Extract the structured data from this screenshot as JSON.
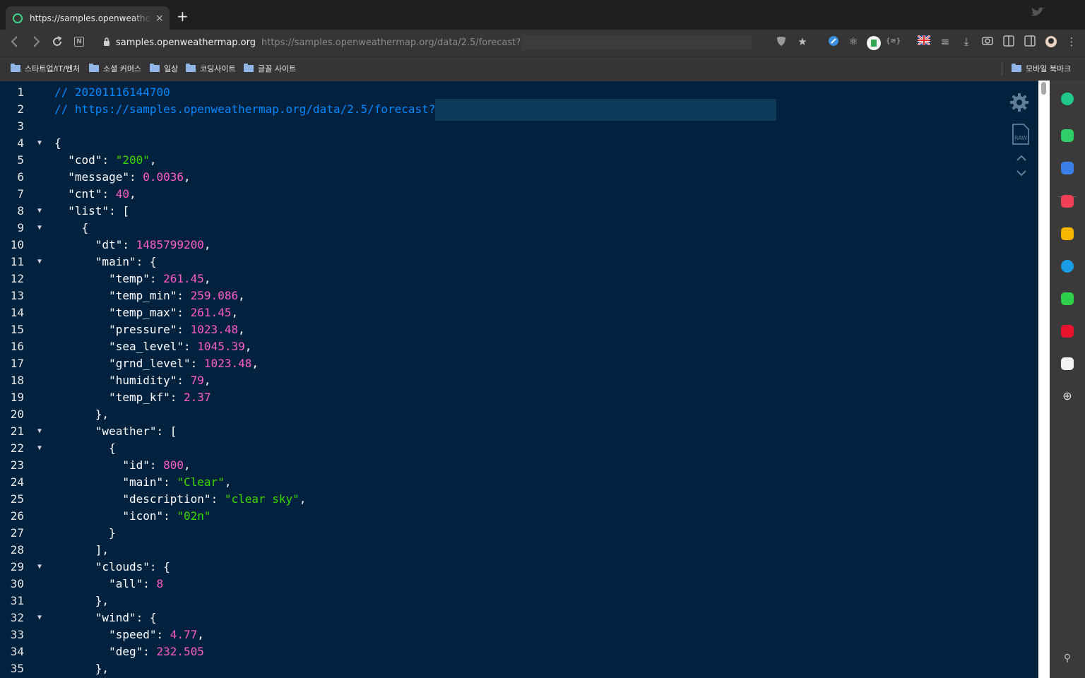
{
  "tab": {
    "title": "https://samples.openweathermap.org",
    "close": "×",
    "new": "+"
  },
  "address": {
    "host": "samples.openweathermap.org",
    "url": "https://samples.openweathermap.org/data/2.5/forecast?"
  },
  "bookmarks": [
    {
      "label": "스타트업/IT/벤처"
    },
    {
      "label": "소셜 커머스"
    },
    {
      "label": "일상"
    },
    {
      "label": "코딩사이트"
    },
    {
      "label": "글꼴 사이트"
    }
  ],
  "mobile_bookmarks": "모바일 북마크",
  "code_lines": [
    {
      "n": "1",
      "fold": "",
      "tokens": [
        [
          "c",
          "// 20201116144700"
        ]
      ]
    },
    {
      "n": "2",
      "fold": "",
      "tokens": [
        [
          "c",
          "// https://samples.openweathermap.org/data/2.5/forecast?"
        ]
      ]
    },
    {
      "n": "3",
      "fold": "",
      "tokens": []
    },
    {
      "n": "4",
      "fold": "▼",
      "tokens": [
        [
          "p",
          "{"
        ]
      ]
    },
    {
      "n": "5",
      "fold": "",
      "tokens": [
        [
          "p",
          "  "
        ],
        [
          "k",
          "\"cod\""
        ],
        [
          "p",
          ": "
        ],
        [
          "s",
          "\"200\""
        ],
        [
          "p",
          ","
        ]
      ]
    },
    {
      "n": "6",
      "fold": "",
      "tokens": [
        [
          "p",
          "  "
        ],
        [
          "k",
          "\"message\""
        ],
        [
          "p",
          ": "
        ],
        [
          "n",
          "0.0036"
        ],
        [
          "p",
          ","
        ]
      ]
    },
    {
      "n": "7",
      "fold": "",
      "tokens": [
        [
          "p",
          "  "
        ],
        [
          "k",
          "\"cnt\""
        ],
        [
          "p",
          ": "
        ],
        [
          "n",
          "40"
        ],
        [
          "p",
          ","
        ]
      ]
    },
    {
      "n": "8",
      "fold": "▼",
      "tokens": [
        [
          "p",
          "  "
        ],
        [
          "k",
          "\"list\""
        ],
        [
          "p",
          ": ["
        ]
      ]
    },
    {
      "n": "9",
      "fold": "▼",
      "tokens": [
        [
          "p",
          "    {"
        ]
      ]
    },
    {
      "n": "10",
      "fold": "",
      "tokens": [
        [
          "p",
          "      "
        ],
        [
          "k",
          "\"dt\""
        ],
        [
          "p",
          ": "
        ],
        [
          "n",
          "1485799200"
        ],
        [
          "p",
          ","
        ]
      ]
    },
    {
      "n": "11",
      "fold": "▼",
      "tokens": [
        [
          "p",
          "      "
        ],
        [
          "k",
          "\"main\""
        ],
        [
          "p",
          ": {"
        ]
      ]
    },
    {
      "n": "12",
      "fold": "",
      "tokens": [
        [
          "p",
          "        "
        ],
        [
          "k",
          "\"temp\""
        ],
        [
          "p",
          ": "
        ],
        [
          "n",
          "261.45"
        ],
        [
          "p",
          ","
        ]
      ]
    },
    {
      "n": "13",
      "fold": "",
      "tokens": [
        [
          "p",
          "        "
        ],
        [
          "k",
          "\"temp_min\""
        ],
        [
          "p",
          ": "
        ],
        [
          "n",
          "259.086"
        ],
        [
          "p",
          ","
        ]
      ]
    },
    {
      "n": "14",
      "fold": "",
      "tokens": [
        [
          "p",
          "        "
        ],
        [
          "k",
          "\"temp_max\""
        ],
        [
          "p",
          ": "
        ],
        [
          "n",
          "261.45"
        ],
        [
          "p",
          ","
        ]
      ]
    },
    {
      "n": "15",
      "fold": "",
      "tokens": [
        [
          "p",
          "        "
        ],
        [
          "k",
          "\"pressure\""
        ],
        [
          "p",
          ": "
        ],
        [
          "n",
          "1023.48"
        ],
        [
          "p",
          ","
        ]
      ]
    },
    {
      "n": "16",
      "fold": "",
      "tokens": [
        [
          "p",
          "        "
        ],
        [
          "k",
          "\"sea_level\""
        ],
        [
          "p",
          ": "
        ],
        [
          "n",
          "1045.39"
        ],
        [
          "p",
          ","
        ]
      ]
    },
    {
      "n": "17",
      "fold": "",
      "tokens": [
        [
          "p",
          "        "
        ],
        [
          "k",
          "\"grnd_level\""
        ],
        [
          "p",
          ": "
        ],
        [
          "n",
          "1023.48"
        ],
        [
          "p",
          ","
        ]
      ]
    },
    {
      "n": "18",
      "fold": "",
      "tokens": [
        [
          "p",
          "        "
        ],
        [
          "k",
          "\"humidity\""
        ],
        [
          "p",
          ": "
        ],
        [
          "n",
          "79"
        ],
        [
          "p",
          ","
        ]
      ]
    },
    {
      "n": "19",
      "fold": "",
      "tokens": [
        [
          "p",
          "        "
        ],
        [
          "k",
          "\"temp_kf\""
        ],
        [
          "p",
          ": "
        ],
        [
          "n",
          "2.37"
        ]
      ]
    },
    {
      "n": "20",
      "fold": "",
      "tokens": [
        [
          "p",
          "      },"
        ]
      ]
    },
    {
      "n": "21",
      "fold": "▼",
      "tokens": [
        [
          "p",
          "      "
        ],
        [
          "k",
          "\"weather\""
        ],
        [
          "p",
          ": ["
        ]
      ]
    },
    {
      "n": "22",
      "fold": "▼",
      "tokens": [
        [
          "p",
          "        {"
        ]
      ]
    },
    {
      "n": "23",
      "fold": "",
      "tokens": [
        [
          "p",
          "          "
        ],
        [
          "k",
          "\"id\""
        ],
        [
          "p",
          ": "
        ],
        [
          "n",
          "800"
        ],
        [
          "p",
          ","
        ]
      ]
    },
    {
      "n": "24",
      "fold": "",
      "tokens": [
        [
          "p",
          "          "
        ],
        [
          "k",
          "\"main\""
        ],
        [
          "p",
          ": "
        ],
        [
          "s",
          "\"Clear\""
        ],
        [
          "p",
          ","
        ]
      ]
    },
    {
      "n": "25",
      "fold": "",
      "tokens": [
        [
          "p",
          "          "
        ],
        [
          "k",
          "\"description\""
        ],
        [
          "p",
          ": "
        ],
        [
          "s",
          "\"clear sky\""
        ],
        [
          "p",
          ","
        ]
      ]
    },
    {
      "n": "26",
      "fold": "",
      "tokens": [
        [
          "p",
          "          "
        ],
        [
          "k",
          "\"icon\""
        ],
        [
          "p",
          ": "
        ],
        [
          "s",
          "\"02n\""
        ]
      ]
    },
    {
      "n": "27",
      "fold": "",
      "tokens": [
        [
          "p",
          "        }"
        ]
      ]
    },
    {
      "n": "28",
      "fold": "",
      "tokens": [
        [
          "p",
          "      ],"
        ]
      ]
    },
    {
      "n": "29",
      "fold": "▼",
      "tokens": [
        [
          "p",
          "      "
        ],
        [
          "k",
          "\"clouds\""
        ],
        [
          "p",
          ": {"
        ]
      ]
    },
    {
      "n": "30",
      "fold": "",
      "tokens": [
        [
          "p",
          "        "
        ],
        [
          "k",
          "\"all\""
        ],
        [
          "p",
          ": "
        ],
        [
          "n",
          "8"
        ]
      ]
    },
    {
      "n": "31",
      "fold": "",
      "tokens": [
        [
          "p",
          "      },"
        ]
      ]
    },
    {
      "n": "32",
      "fold": "▼",
      "tokens": [
        [
          "p",
          "      "
        ],
        [
          "k",
          "\"wind\""
        ],
        [
          "p",
          ": {"
        ]
      ]
    },
    {
      "n": "33",
      "fold": "",
      "tokens": [
        [
          "p",
          "        "
        ],
        [
          "k",
          "\"speed\""
        ],
        [
          "p",
          ": "
        ],
        [
          "n",
          "4.77"
        ],
        [
          "p",
          ","
        ]
      ]
    },
    {
      "n": "34",
      "fold": "",
      "tokens": [
        [
          "p",
          "        "
        ],
        [
          "k",
          "\"deg\""
        ],
        [
          "p",
          ": "
        ],
        [
          "n",
          "232.505"
        ]
      ]
    },
    {
      "n": "35",
      "fold": "",
      "tokens": [
        [
          "p",
          "      },"
        ]
      ]
    }
  ],
  "colors": {
    "background": "#00223f",
    "comment": "#0088ff",
    "string": "#3ad900",
    "number": "#ff5dc8",
    "key": "#ffffff"
  },
  "icons": {
    "settings": "gear-icon",
    "raw": "raw-file-icon",
    "collapse": "chevron-up-down-icon"
  }
}
